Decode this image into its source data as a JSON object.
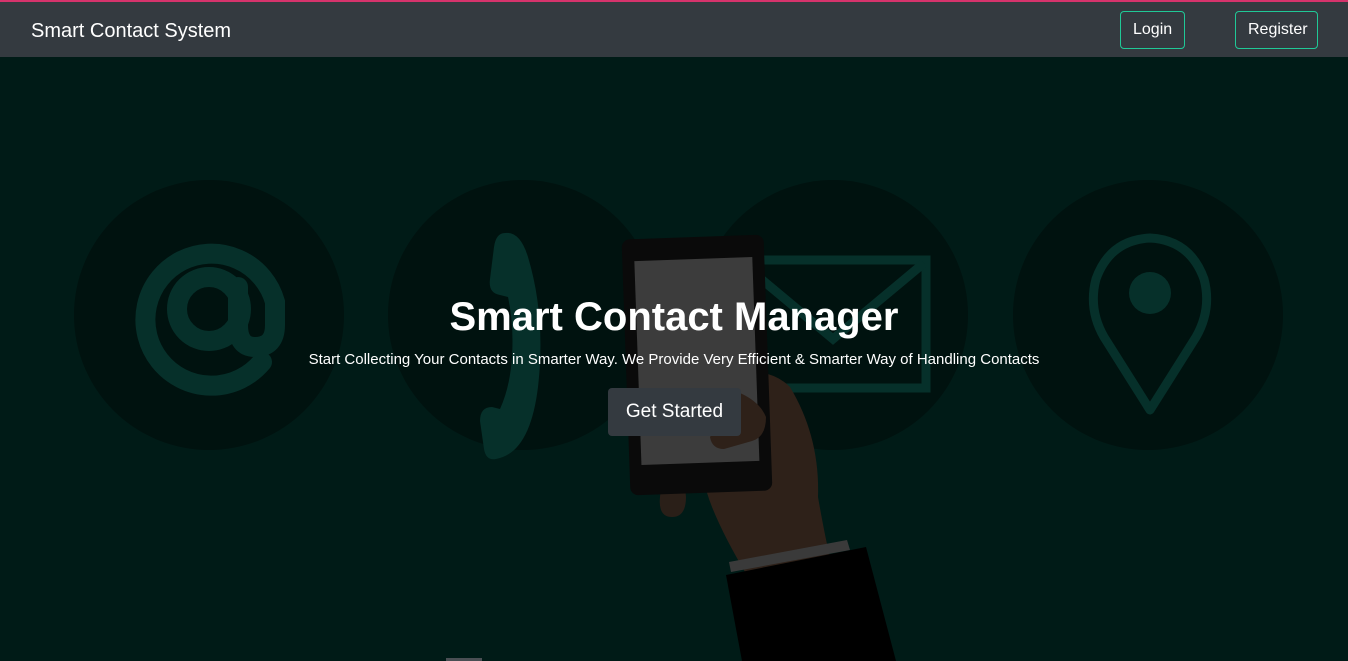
{
  "navbar": {
    "brand": "Smart Contact System",
    "login_label": "Login",
    "register_label": "Register"
  },
  "hero": {
    "title": "Smart Contact Manager",
    "subtitle": "Start Collecting Your Contacts in Smarter Way. We Provide Very Efficient & Smarter Way of Handling Contacts",
    "cta_label": "Get Started",
    "background_icons": [
      "at-sign-icon",
      "phone-handset-icon",
      "envelope-icon",
      "map-pin-icon"
    ],
    "background_illustration": "hand-holding-smartphone"
  },
  "colors": {
    "accent_line": "#d6336c",
    "navbar_bg": "#343a40",
    "nav_button_border": "#20c997",
    "hero_bg": "#001b17",
    "icon_circle": "#00120f",
    "icon_stroke": "#06302a",
    "cta_bg": "#343a40"
  }
}
